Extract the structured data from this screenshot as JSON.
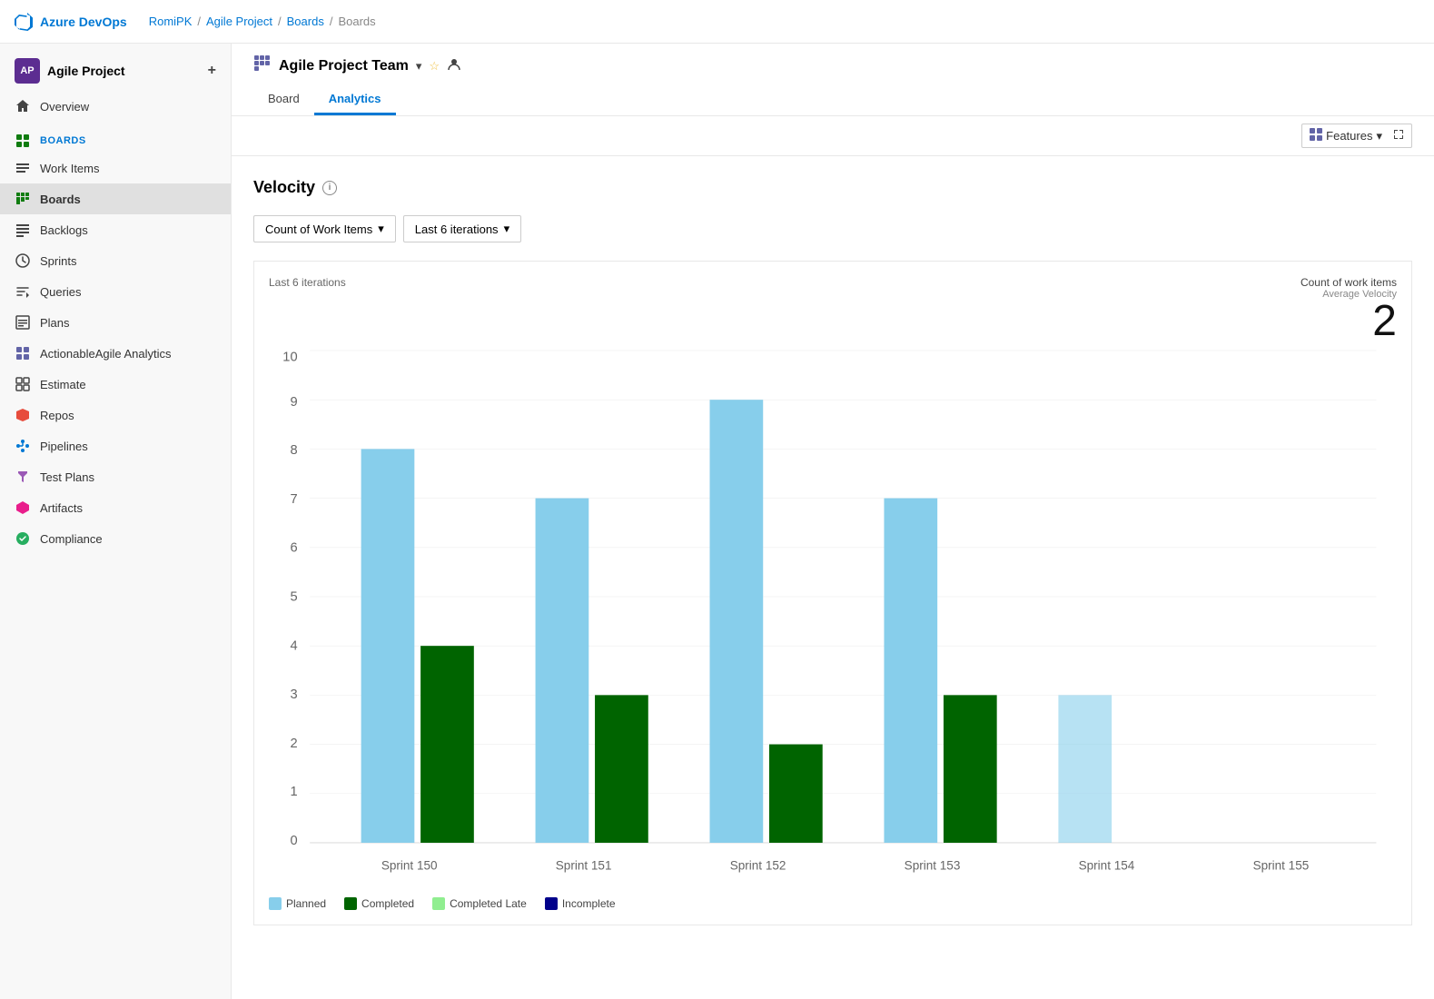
{
  "topbar": {
    "logo_text": "Azure DevOps",
    "breadcrumb": [
      "RomiPK",
      "Agile Project",
      "Boards",
      "Boards"
    ]
  },
  "sidebar": {
    "project_name": "Agile Project",
    "project_initials": "AP",
    "items": [
      {
        "id": "overview",
        "label": "Overview",
        "icon": "home"
      },
      {
        "id": "boards-group",
        "label": "Boards",
        "icon": "boards-group"
      },
      {
        "id": "work-items",
        "label": "Work Items",
        "icon": "work-items"
      },
      {
        "id": "boards",
        "label": "Boards",
        "icon": "boards",
        "active": true
      },
      {
        "id": "backlogs",
        "label": "Backlogs",
        "icon": "backlogs"
      },
      {
        "id": "sprints",
        "label": "Sprints",
        "icon": "sprints"
      },
      {
        "id": "queries",
        "label": "Queries",
        "icon": "queries"
      },
      {
        "id": "plans",
        "label": "Plans",
        "icon": "plans"
      },
      {
        "id": "actionable-agile",
        "label": "ActionableAgile Analytics",
        "icon": "actionable-agile"
      },
      {
        "id": "estimate",
        "label": "Estimate",
        "icon": "estimate"
      },
      {
        "id": "repos",
        "label": "Repos",
        "icon": "repos"
      },
      {
        "id": "pipelines",
        "label": "Pipelines",
        "icon": "pipelines"
      },
      {
        "id": "test-plans",
        "label": "Test Plans",
        "icon": "test-plans"
      },
      {
        "id": "artifacts",
        "label": "Artifacts",
        "icon": "artifacts"
      },
      {
        "id": "compliance",
        "label": "Compliance",
        "icon": "compliance"
      }
    ]
  },
  "main": {
    "team_name": "Agile Project Team",
    "tabs": [
      {
        "id": "board",
        "label": "Board",
        "active": false
      },
      {
        "id": "analytics",
        "label": "Analytics",
        "active": true
      }
    ],
    "features_label": "Features",
    "velocity": {
      "title": "Velocity",
      "filter_metric": "Count of Work Items",
      "filter_iterations": "Last 6 iterations",
      "chart_subtitle": "Last 6 iterations",
      "metric_label": "Count of work items",
      "metric_sublabel": "Average Velocity",
      "metric_value": "2",
      "y_max": 10,
      "y_labels": [
        0,
        1,
        2,
        3,
        4,
        5,
        6,
        7,
        8,
        9,
        10
      ],
      "sprints": [
        {
          "label": "Sprint 150",
          "planned": 8,
          "completed": 4,
          "completed_late": 0,
          "incomplete": 0
        },
        {
          "label": "Sprint 151",
          "planned": 7,
          "completed": 3,
          "completed_late": 0,
          "incomplete": 0
        },
        {
          "label": "Sprint 152",
          "planned": 9,
          "completed": 2,
          "completed_late": 0,
          "incomplete": 0
        },
        {
          "label": "Sprint 153",
          "planned": 7,
          "completed": 3,
          "completed_late": 0,
          "incomplete": 0
        },
        {
          "label": "Sprint 154",
          "planned": 3,
          "completed": 0,
          "completed_late": 0,
          "incomplete": 0
        },
        {
          "label": "Sprint 155",
          "planned": 0,
          "completed": 0,
          "completed_late": 0,
          "incomplete": 0
        }
      ],
      "legend": [
        {
          "id": "planned",
          "label": "Planned",
          "color": "#87CEEB"
        },
        {
          "id": "completed",
          "label": "Completed",
          "color": "#006400"
        },
        {
          "id": "completed-late",
          "label": "Completed Late",
          "color": "#90EE90"
        },
        {
          "id": "incomplete",
          "label": "Incomplete",
          "color": "#00008B"
        }
      ]
    }
  }
}
